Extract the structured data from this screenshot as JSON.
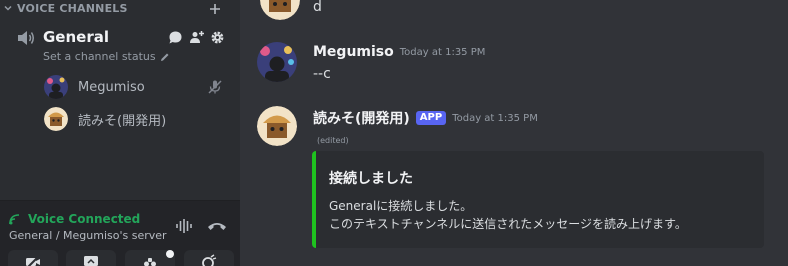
{
  "sidebar": {
    "section_title": "VOICE CHANNELS",
    "channel": {
      "name": "General",
      "status_placeholder": "Set a channel status"
    },
    "voice_users": [
      {
        "name": "Megumiso",
        "muted": true
      },
      {
        "name": "読みそ(開発用)",
        "muted": false
      }
    ],
    "voice_panel": {
      "status": "Voice Connected",
      "subtitle": "General / Megumiso's server",
      "status_color": "#23a55a"
    }
  },
  "chat": {
    "prev_message_text": "d",
    "messages": [
      {
        "author": "Megumiso",
        "timestamp": "Today at 1:35 PM",
        "text": "--c"
      },
      {
        "author": "読みそ(開発用)",
        "tag": "APP",
        "timestamp": "Today at 1:35 PM",
        "edited_label": "(edited)",
        "embed": {
          "title": "接続しました",
          "line1": "Generalに接続しました。",
          "line2": "このテキストチャンネルに送信されたメッセージを読み上げます。",
          "accent_color": "#1fc21f"
        }
      }
    ]
  },
  "colors": {
    "background": "#313338",
    "sidebar": "#2b2d31",
    "app_tag": "#5865f2"
  }
}
